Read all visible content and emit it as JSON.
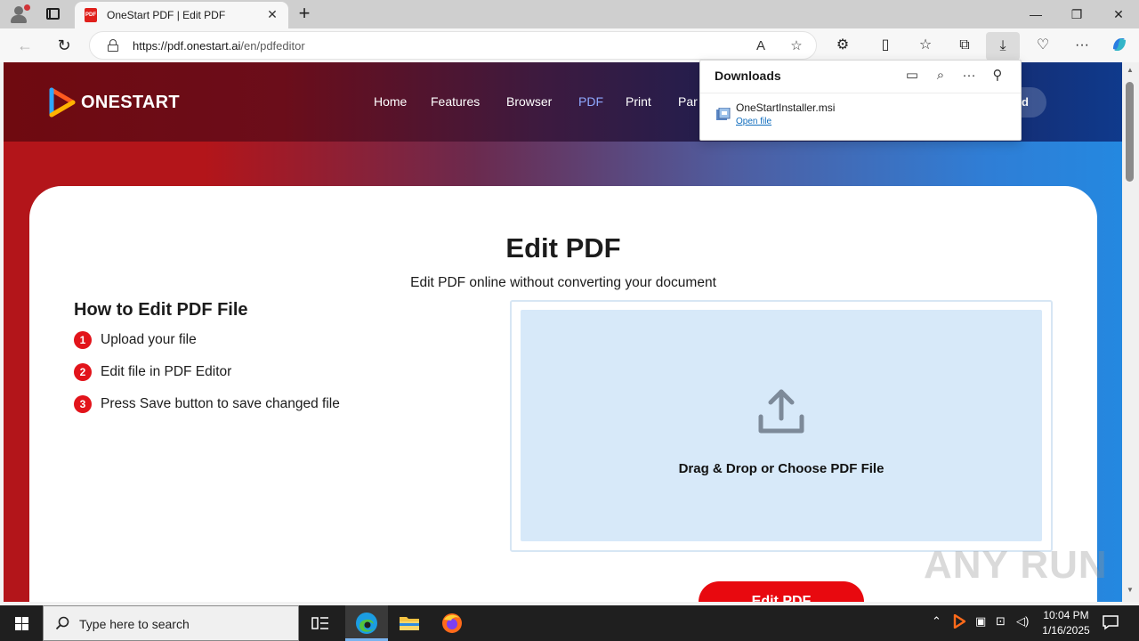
{
  "browser": {
    "tab_title": "OneStart PDF | Edit PDF",
    "tab_favicon_text": "PDF",
    "new_tab_symbol": "+",
    "url_host": "https://pdf.onestart.ai",
    "url_path": "/en/pdfeditor",
    "window_controls": [
      "minimize",
      "restore",
      "close"
    ]
  },
  "site": {
    "brand": "ONESTART",
    "nav": [
      {
        "label": "Home",
        "active": false
      },
      {
        "label": "Features",
        "active": false
      },
      {
        "label": "Browser",
        "active": false
      },
      {
        "label": "PDF",
        "active": true
      },
      {
        "label": "Print",
        "active": false
      },
      {
        "label": "Par",
        "active": false
      }
    ],
    "header_button_partial": "d",
    "title": "Edit PDF",
    "subtitle": "Edit PDF online without converting your document",
    "howto_title": "How to Edit PDF File",
    "steps": [
      {
        "num": "1",
        "text": "Upload your file"
      },
      {
        "num": "2",
        "text": "Edit file in PDF Editor"
      },
      {
        "num": "3",
        "text": "Press Save button to save changed file"
      }
    ],
    "drop_text": "Drag & Drop or Choose PDF File",
    "edit_button": "Edit PDF",
    "accent_color": "#e2141b"
  },
  "downloads": {
    "title": "Downloads",
    "file_name": "OneStartInstaller.msi",
    "open_link": "Open file"
  },
  "watermark": "ANY RUN",
  "taskbar": {
    "search_placeholder": "Type here to search",
    "time": "10:04 PM",
    "date": "1/16/2025"
  }
}
